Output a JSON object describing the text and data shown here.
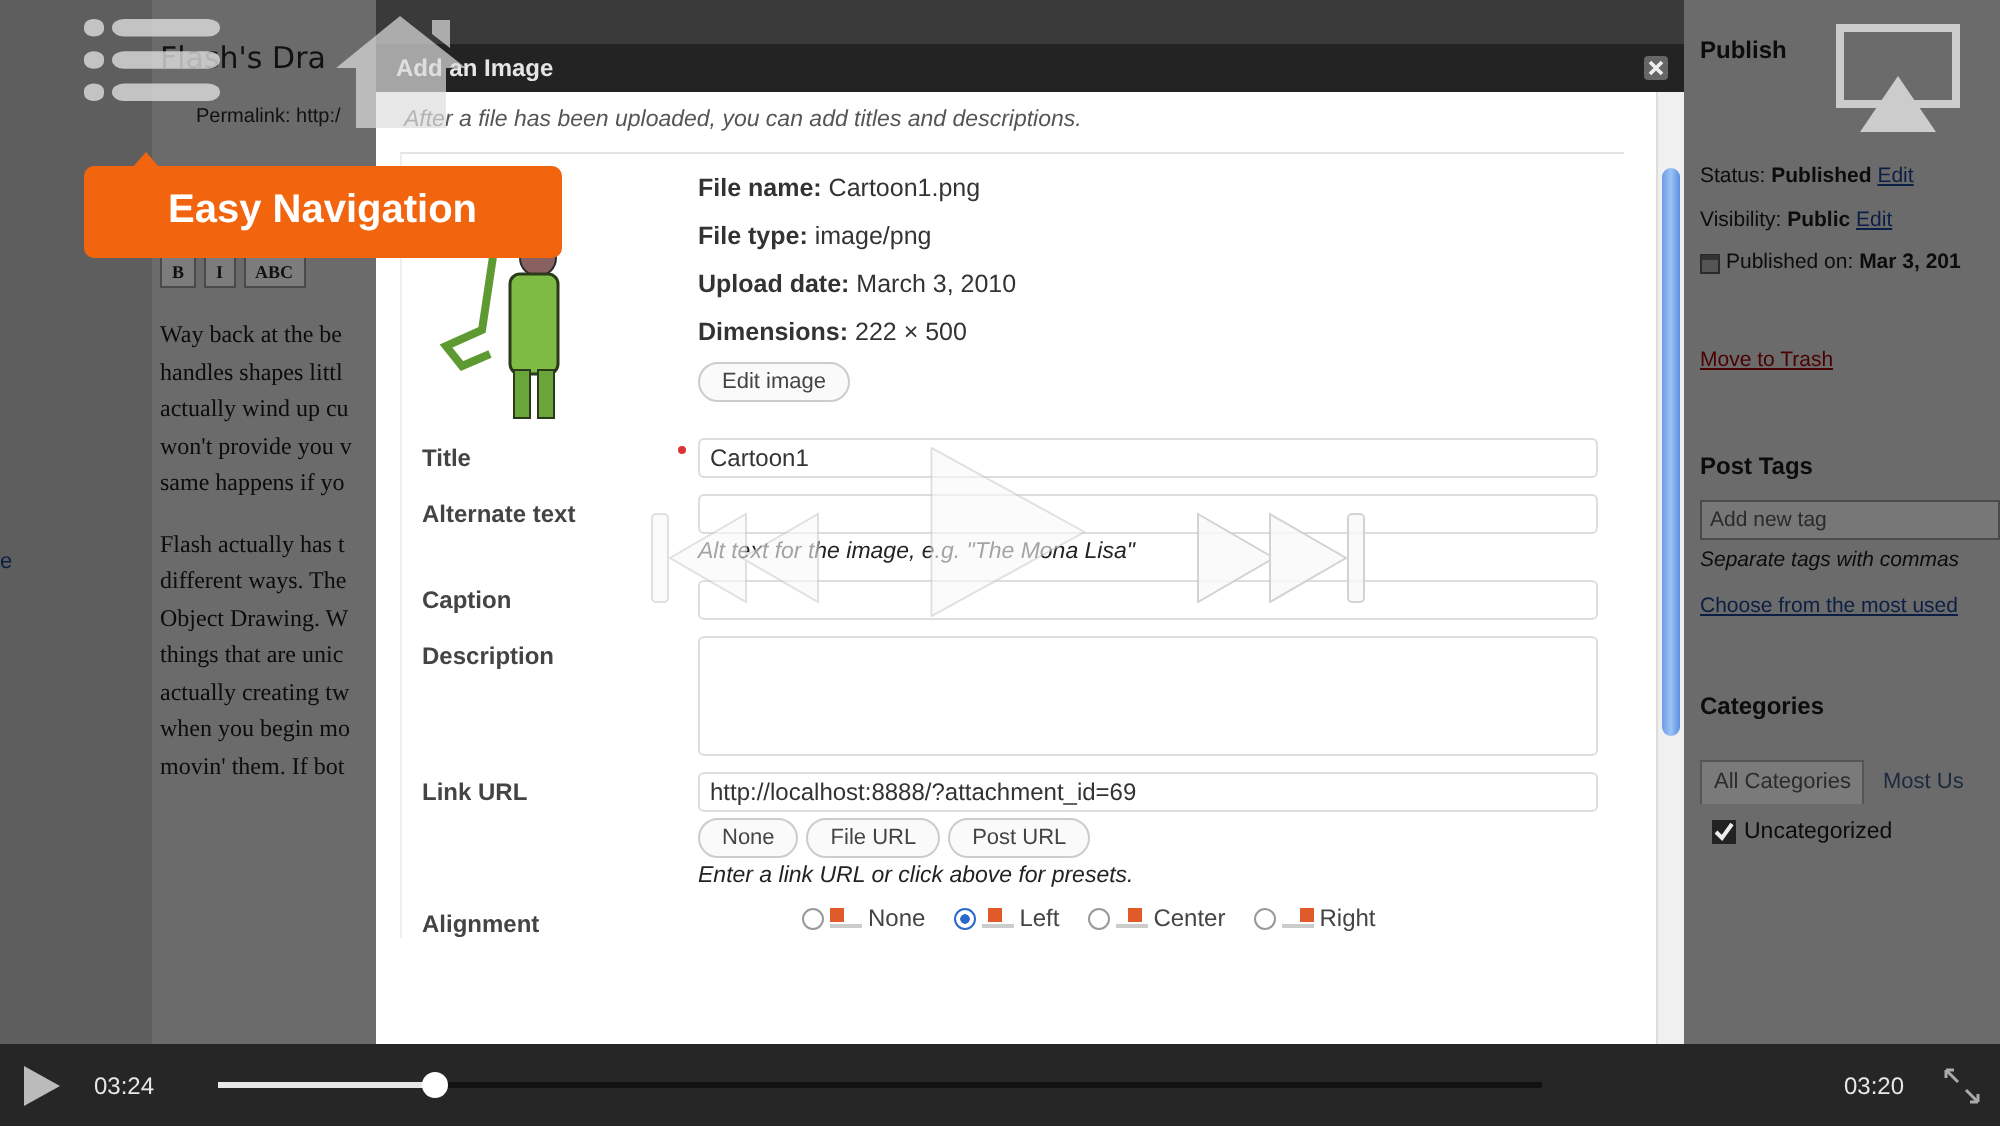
{
  "editor": {
    "post_title": "Flash's Dra",
    "permalink": "Permalink: http:/",
    "side_fragment": "e",
    "toolbar": [
      "B",
      "I",
      "ABC"
    ],
    "paragraphs": [
      [
        "Way back at the be",
        "handles shapes littl",
        "actually wind up cu",
        "won't provide you v",
        "same happens if yo"
      ],
      [
        "Flash actually has t",
        "different ways. The",
        "Object Drawing. W",
        "things that are unic",
        "actually creating tw",
        "when you begin mo",
        "movin' them. If bot"
      ]
    ]
  },
  "dialog": {
    "title": "Add an Image",
    "intro": "After a file has been uploaded, you can add titles and descriptions.",
    "file_info": [
      "**File name:** Cartoon1.png",
      "**File type:** image/png",
      "**Upload date:** March 3, 2010",
      "**Dimensions:** 222 × 500"
    ],
    "edit_button": "Edit image",
    "fields": [
      {
        "kind": "input",
        "label": "Title",
        "required": true,
        "value": "Cartoon1"
      },
      {
        "kind": "input",
        "label": "Alternate text",
        "required": false,
        "help": "Alt text for the image, e.g. \"The Mona Lisa\""
      },
      {
        "kind": "input",
        "label": "Caption",
        "required": false
      },
      {
        "kind": "textarea",
        "label": "Description",
        "required": false
      },
      {
        "kind": "url",
        "label": "Link URL",
        "required": false,
        "value": "http://localhost:8888/?attachment_id=69",
        "buttons": [
          "None",
          "File URL",
          "Post URL"
        ],
        "help": "Enter a link URL or click above for presets."
      },
      {
        "kind": "radios",
        "label": "Alignment",
        "required": false,
        "options": [
          {
            "label": "None",
            "selected": false
          },
          {
            "label": "Left",
            "selected": true
          },
          {
            "label": "Center",
            "selected": false
          },
          {
            "label": "Right",
            "selected": false
          }
        ]
      }
    ]
  },
  "sidebar": {
    "publish": {
      "heading": "Publish",
      "status_label": "Status:",
      "status": "Published",
      "status_edit": "Edit",
      "visibility_label": "Visibility:",
      "visibility": "Public",
      "visibility_edit": "Edit",
      "published_label": "Published on:",
      "published": "Mar 3, 201",
      "trash": "Move to Trash"
    },
    "tags": {
      "heading": "Post Tags",
      "placeholder": "Add new tag",
      "hint": "Separate tags with commas",
      "link": "Choose from the most used"
    },
    "categories": {
      "heading": "Categories",
      "tabs": [
        {
          "label": "All Categories",
          "selected": true
        },
        {
          "label": "Most Us",
          "selected": false
        }
      ],
      "items": [
        {
          "label": "Uncategorized",
          "checked": true
        }
      ]
    }
  },
  "overlay": {
    "tooltip": "Easy Navigation"
  },
  "player": {
    "elapsed": "03:24",
    "remaining": "03:20",
    "progress": {
      "level": 0.164
    }
  }
}
